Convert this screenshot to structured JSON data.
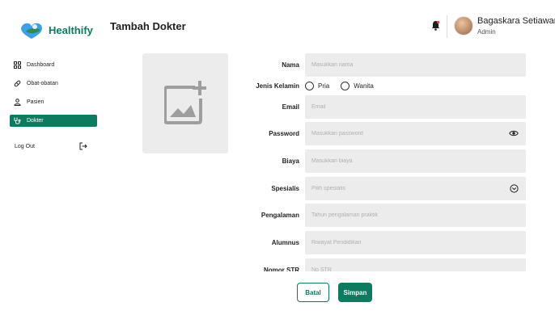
{
  "app": {
    "name": "Healthify",
    "page_title": "Tambah Dokter",
    "brand_color": "#0e7a5f"
  },
  "user": {
    "name": "Bagaskara Setiawan",
    "role": "Admin",
    "notification_icon": "bell-icon"
  },
  "sidebar": {
    "items": [
      {
        "label": "Dashboard",
        "icon": "dashboard-icon",
        "active": false
      },
      {
        "label": "Obat-obatan",
        "icon": "pill-icon",
        "active": false
      },
      {
        "label": "Pasien",
        "icon": "user-icon",
        "active": false
      },
      {
        "label": "Dokter",
        "icon": "doctor-icon",
        "active": true
      }
    ],
    "logout": {
      "label": "Log Out",
      "icon": "logout-icon"
    }
  },
  "form": {
    "photo": {
      "icon": "add-image-icon"
    },
    "nama": {
      "label": "Nama",
      "placeholder": "Masukkan nama",
      "value": ""
    },
    "gender": {
      "label": "Jenis Kelamin",
      "options": [
        "Pria",
        "Wanita"
      ],
      "selected": ""
    },
    "email": {
      "label": "Email",
      "placeholder": "Email",
      "value": ""
    },
    "password": {
      "label": "Password",
      "placeholder": "Masukkan password",
      "value": "",
      "icon": "eye-icon"
    },
    "biaya": {
      "label": "Biaya",
      "placeholder": "Masukkan biaya",
      "value": ""
    },
    "spesialis": {
      "label": "Spesialis",
      "placeholder": "Pilih spesialis",
      "value": "",
      "icon": "chevron-down-icon"
    },
    "pengalaman": {
      "label": "Pengalaman",
      "placeholder": "Tahun pengalaman praktik",
      "value": ""
    },
    "alumnus": {
      "label": "Alumnus",
      "placeholder": "Riwayat Pendidikan",
      "value": ""
    },
    "nomor_str": {
      "label": "Nomor STR",
      "placeholder": "No STR",
      "value": ""
    }
  },
  "actions": {
    "cancel_label": "Batal",
    "save_label": "Simpan"
  }
}
